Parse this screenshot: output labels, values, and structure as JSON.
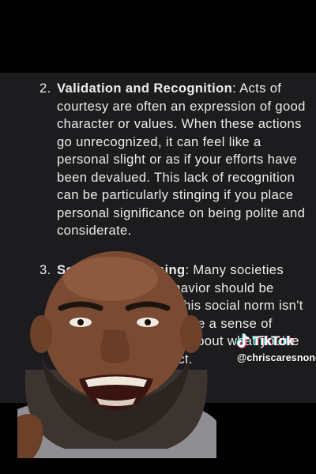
{
  "document": {
    "clipped_top_line": "",
    "item2": {
      "number": "2.",
      "title": "Validation and Recognition",
      "body": ": Acts of courtesy are often an expression of good character or values. When these actions go unrecognized, it can feel like a personal slight or as if your efforts have been devalued. This lack of recognition can be particularly stinging if you place personal significance on being polite and considerate."
    },
    "item3": {
      "number": "3.",
      "title": "Social Conditioning",
      "body": ": Many societies teach that polite behavior should be reciprocated. When this social norm isn't adhered to, it can create a sense of injustice or confusion about what you've been taught to expect."
    }
  },
  "watermark": {
    "brand": "TikTok",
    "handle": "@chriscaresnone",
    "brand_colors": {
      "cyan": "#25F4EE",
      "red": "#FE2C55"
    },
    "icon": "tiktok-note-icon"
  },
  "colors": {
    "background": "#000000",
    "document_bg": "#1c1c1e",
    "text": "#ececec"
  }
}
